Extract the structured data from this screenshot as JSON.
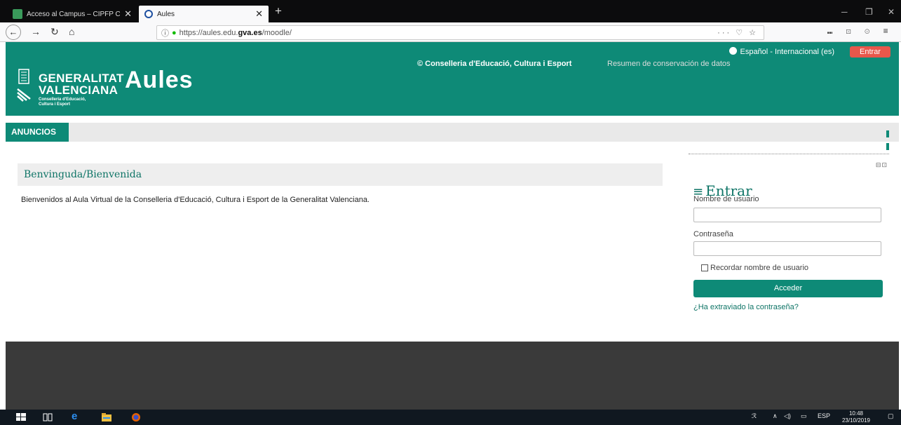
{
  "browser": {
    "tabs": [
      {
        "title": "Acceso al Campus – CIPFP Can",
        "active": false
      },
      {
        "title": "Aules",
        "active": true
      }
    ],
    "url_prefix": "https://aules.edu.",
    "url_domain": "gva.es",
    "url_suffix": "/moodle/",
    "url_actions": "··· ♡ ☆",
    "toolbar_right": "⑉ ⊡ ⊙ ≡"
  },
  "header": {
    "language": "Español - Internacional (es)",
    "login_button": "Entrar",
    "brand_line1": "GENERALITAT",
    "brand_line2": "VALENCIANA",
    "brand_line3": "Conselleria d'Educació,",
    "brand_line4": "Cultura i Esport",
    "site_name": "Aules"
  },
  "menu": {
    "items": [
      {
        "label": "ANUNCIOS"
      }
    ]
  },
  "main": {
    "heading": "Benvinguda/Bienvenida",
    "text": "Bienvenidos al Aula Virtual de la Conselleria d'Educació, Cultura i Esport de la Generalitat Valenciana."
  },
  "login": {
    "title": "Entrar",
    "username_label": "Nombre de usuario",
    "username_value": "",
    "password_label": "Contraseña",
    "password_value": "",
    "remember_label": "Recordar nombre de usuario",
    "remember_checked": false,
    "submit_label": "Acceder",
    "forgot_link": "¿Ha extraviado la contraseña?"
  },
  "footer": {
    "copyright": "© Conselleria d'Educació, Cultura i Esport",
    "data_link": "Resumen de conservación de datos"
  },
  "taskbar": {
    "language": "ESP",
    "time": "10:48",
    "date": "23/10/2019"
  },
  "colors": {
    "brand": "#0e8a77",
    "accent_red": "#e8574b",
    "footer": "#3a3a3a"
  }
}
